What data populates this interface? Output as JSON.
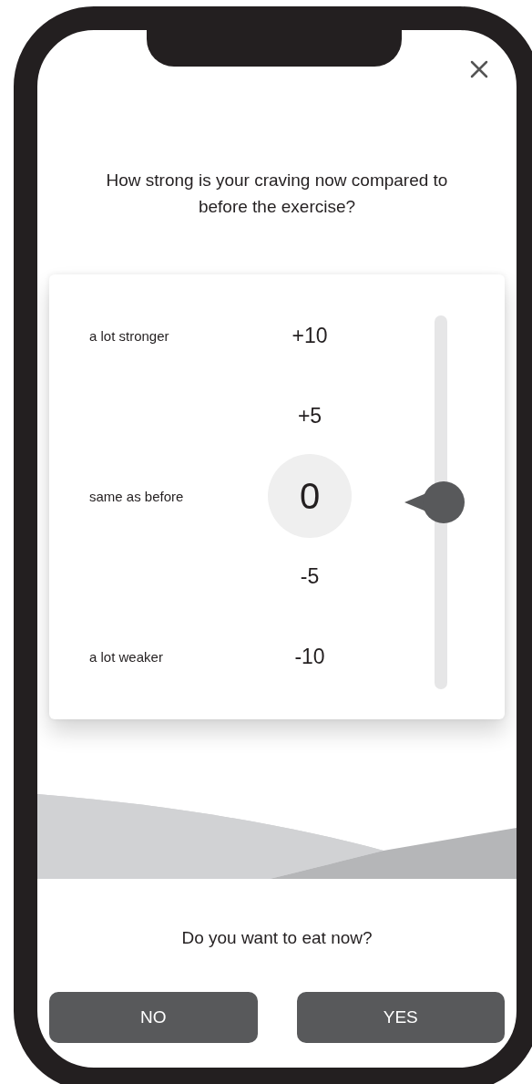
{
  "question": "How strong is your craving now compared to before the exercise?",
  "scale": [
    {
      "label": "a lot stronger",
      "value": "+10",
      "selected": false
    },
    {
      "value": "+5",
      "selected": false
    },
    {
      "label": "same as before",
      "value": "0",
      "selected": true
    },
    {
      "value": "-5",
      "selected": false
    },
    {
      "label": "a lot weaker",
      "value": "-10",
      "selected": false
    }
  ],
  "slider": {
    "level": 0.5
  },
  "prompt": "Do you want to eat now?",
  "buttons": [
    "NO",
    "YES"
  ]
}
